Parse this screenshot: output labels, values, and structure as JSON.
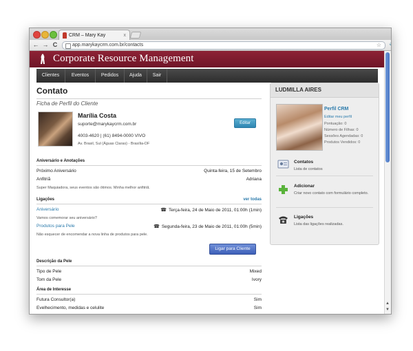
{
  "browser": {
    "tab_title": "CRM – Mary Kay",
    "tab_close": "x",
    "back": "←",
    "forward": "→",
    "reload": "C",
    "url_host": "app.marykaycrm.com.br/",
    "url_path": "contacts",
    "star": "☆",
    "wrench": "🔧"
  },
  "banner": {
    "brand": "Corporate Resource Management"
  },
  "menu": {
    "items": [
      {
        "label": "Clientes"
      },
      {
        "label": "Eventos"
      },
      {
        "label": "Pedidos"
      },
      {
        "label": "Ajuda"
      },
      {
        "label": "Sair"
      }
    ]
  },
  "main": {
    "title": "Contato",
    "subtitle": "Ficha de Perfil do Cliente",
    "profile": {
      "name": "Marília Costa",
      "email": "suporte@marykaycrm.com.br",
      "phones": "4003-4620 | (61) 8494-0000 VIVO",
      "address": "Av. Brasil, Sul (Águas Claras) - Brasília-DF",
      "edit_label": "Editar"
    },
    "aniversario": {
      "title": "Aniversário e Anotações",
      "row1_label": "Próximo Aniversário",
      "row1_value": "Quinta-feira, 15 de Setembro",
      "row2_label": "Anfitriã",
      "row2_value": "Adriana",
      "note": "Super Maquiadora, seus eventos são ótimos. Minha melhor anfitriã."
    },
    "ligacoes": {
      "title": "Ligações",
      "ver_todas": "ver todas",
      "items": [
        {
          "label": "Aniversário",
          "date": "Terça-feira, 24 de Maio de 2011, 01:00h (1min)",
          "note": "Vamos comemorar seu aniversário?"
        },
        {
          "label": "Produtos para Pele",
          "date": "Segunda-feira, 23 de Maio de 2011, 01:00h (5min)",
          "note": "Não esquecer de encomendar a nova linha de produtos para pele."
        }
      ],
      "phone_glyph": "☎",
      "button_label": "Ligar para Cliente"
    },
    "pele": {
      "title": "Descrição da Pele",
      "row1_label": "Tipo de Pele",
      "row1_value": "Mixed",
      "row2_label": "Tom da Pele",
      "row2_value": "Ivory"
    },
    "interesse": {
      "title": "Área de Interesse",
      "row1_label": "Futura Consultor(a)",
      "row1_value": "Sim",
      "row2_label": "Evelhecimento, medidas e celulite",
      "row2_value": "Sim"
    }
  },
  "sidebar": {
    "user_name": "LUDMILLA AIRES",
    "perfil_title": "Perfil CRM",
    "perfil_edit": "Editar meu perfil",
    "stats": [
      {
        "text": "Pontuação: 0"
      },
      {
        "text": "Número de Filhas: 0"
      },
      {
        "text": "Sessões Agendadas: 0"
      },
      {
        "text": "Produtos Vendidos: 0"
      }
    ],
    "items": [
      {
        "title": "Contatos",
        "desc": "Lista de contatos",
        "icon": "contacts-card-icon"
      },
      {
        "title": "Adicionar",
        "desc": "Criar novo contato com formulário completo.",
        "icon": "plus-icon"
      },
      {
        "title": "Ligações",
        "desc": "Lista das ligações realizadas.",
        "icon": "telephone-icon"
      }
    ]
  },
  "colors": {
    "banner": "#7d1a2e",
    "menubar": "#333333",
    "link": "#2a7aab",
    "edit_button": "#3d98c4",
    "call_button": "#4d6fc6"
  }
}
